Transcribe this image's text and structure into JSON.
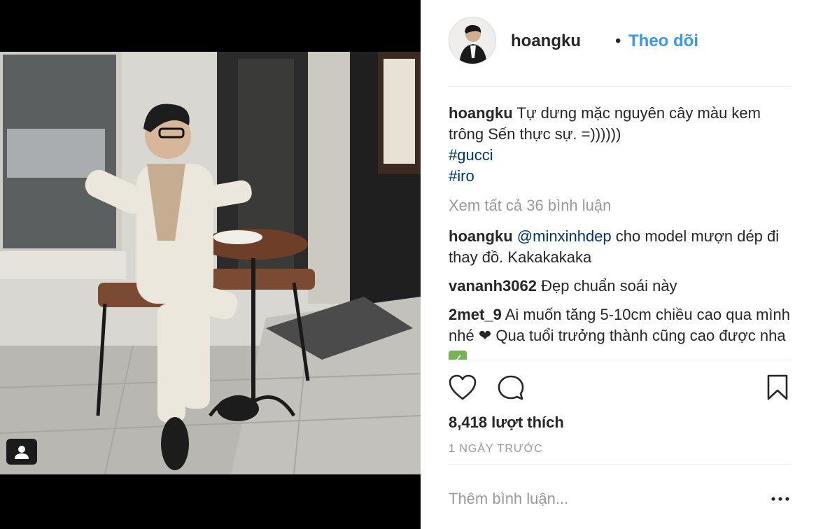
{
  "post": {
    "username": "hoangku",
    "separator": "•",
    "follow_label": "Theo dõi",
    "caption": {
      "username": "hoangku",
      "text": "Tự dưng mặc nguyên cây màu kem trông Sến thực sự. =))))))",
      "hashtags": [
        "#gucci",
        "#iro"
      ]
    },
    "view_all_comments": "Xem tất cả 36 bình luận",
    "comments": [
      {
        "username": "hoangku",
        "mention": "@minxinhdep",
        "text": " cho model mượn dép đi thay đồ. Kakakakaka"
      },
      {
        "username": "vananh3062",
        "mention": "",
        "text": "Đẹp chuẩn soái này"
      },
      {
        "username": "2met_9",
        "mention": "",
        "text": "Ai muốn tăng 5-10cm chiều cao qua mình nhé ❤ Qua tuổi trưởng thành cũng cao được nha"
      }
    ],
    "likes": "8,418 lượt thích",
    "timestamp": "1 NGÀY TRƯỚC",
    "comment_placeholder": "Thêm bình luận..."
  },
  "icons": {
    "like": "heart-icon",
    "comment": "comment-bubble-icon",
    "save": "bookmark-icon",
    "more": "more-options-icon",
    "tagged": "user-tag-icon",
    "check": "check-mark-icon"
  },
  "colors": {
    "link": "#3897f0",
    "hashtag": "#003569",
    "muted": "#999999",
    "text": "#262626"
  }
}
